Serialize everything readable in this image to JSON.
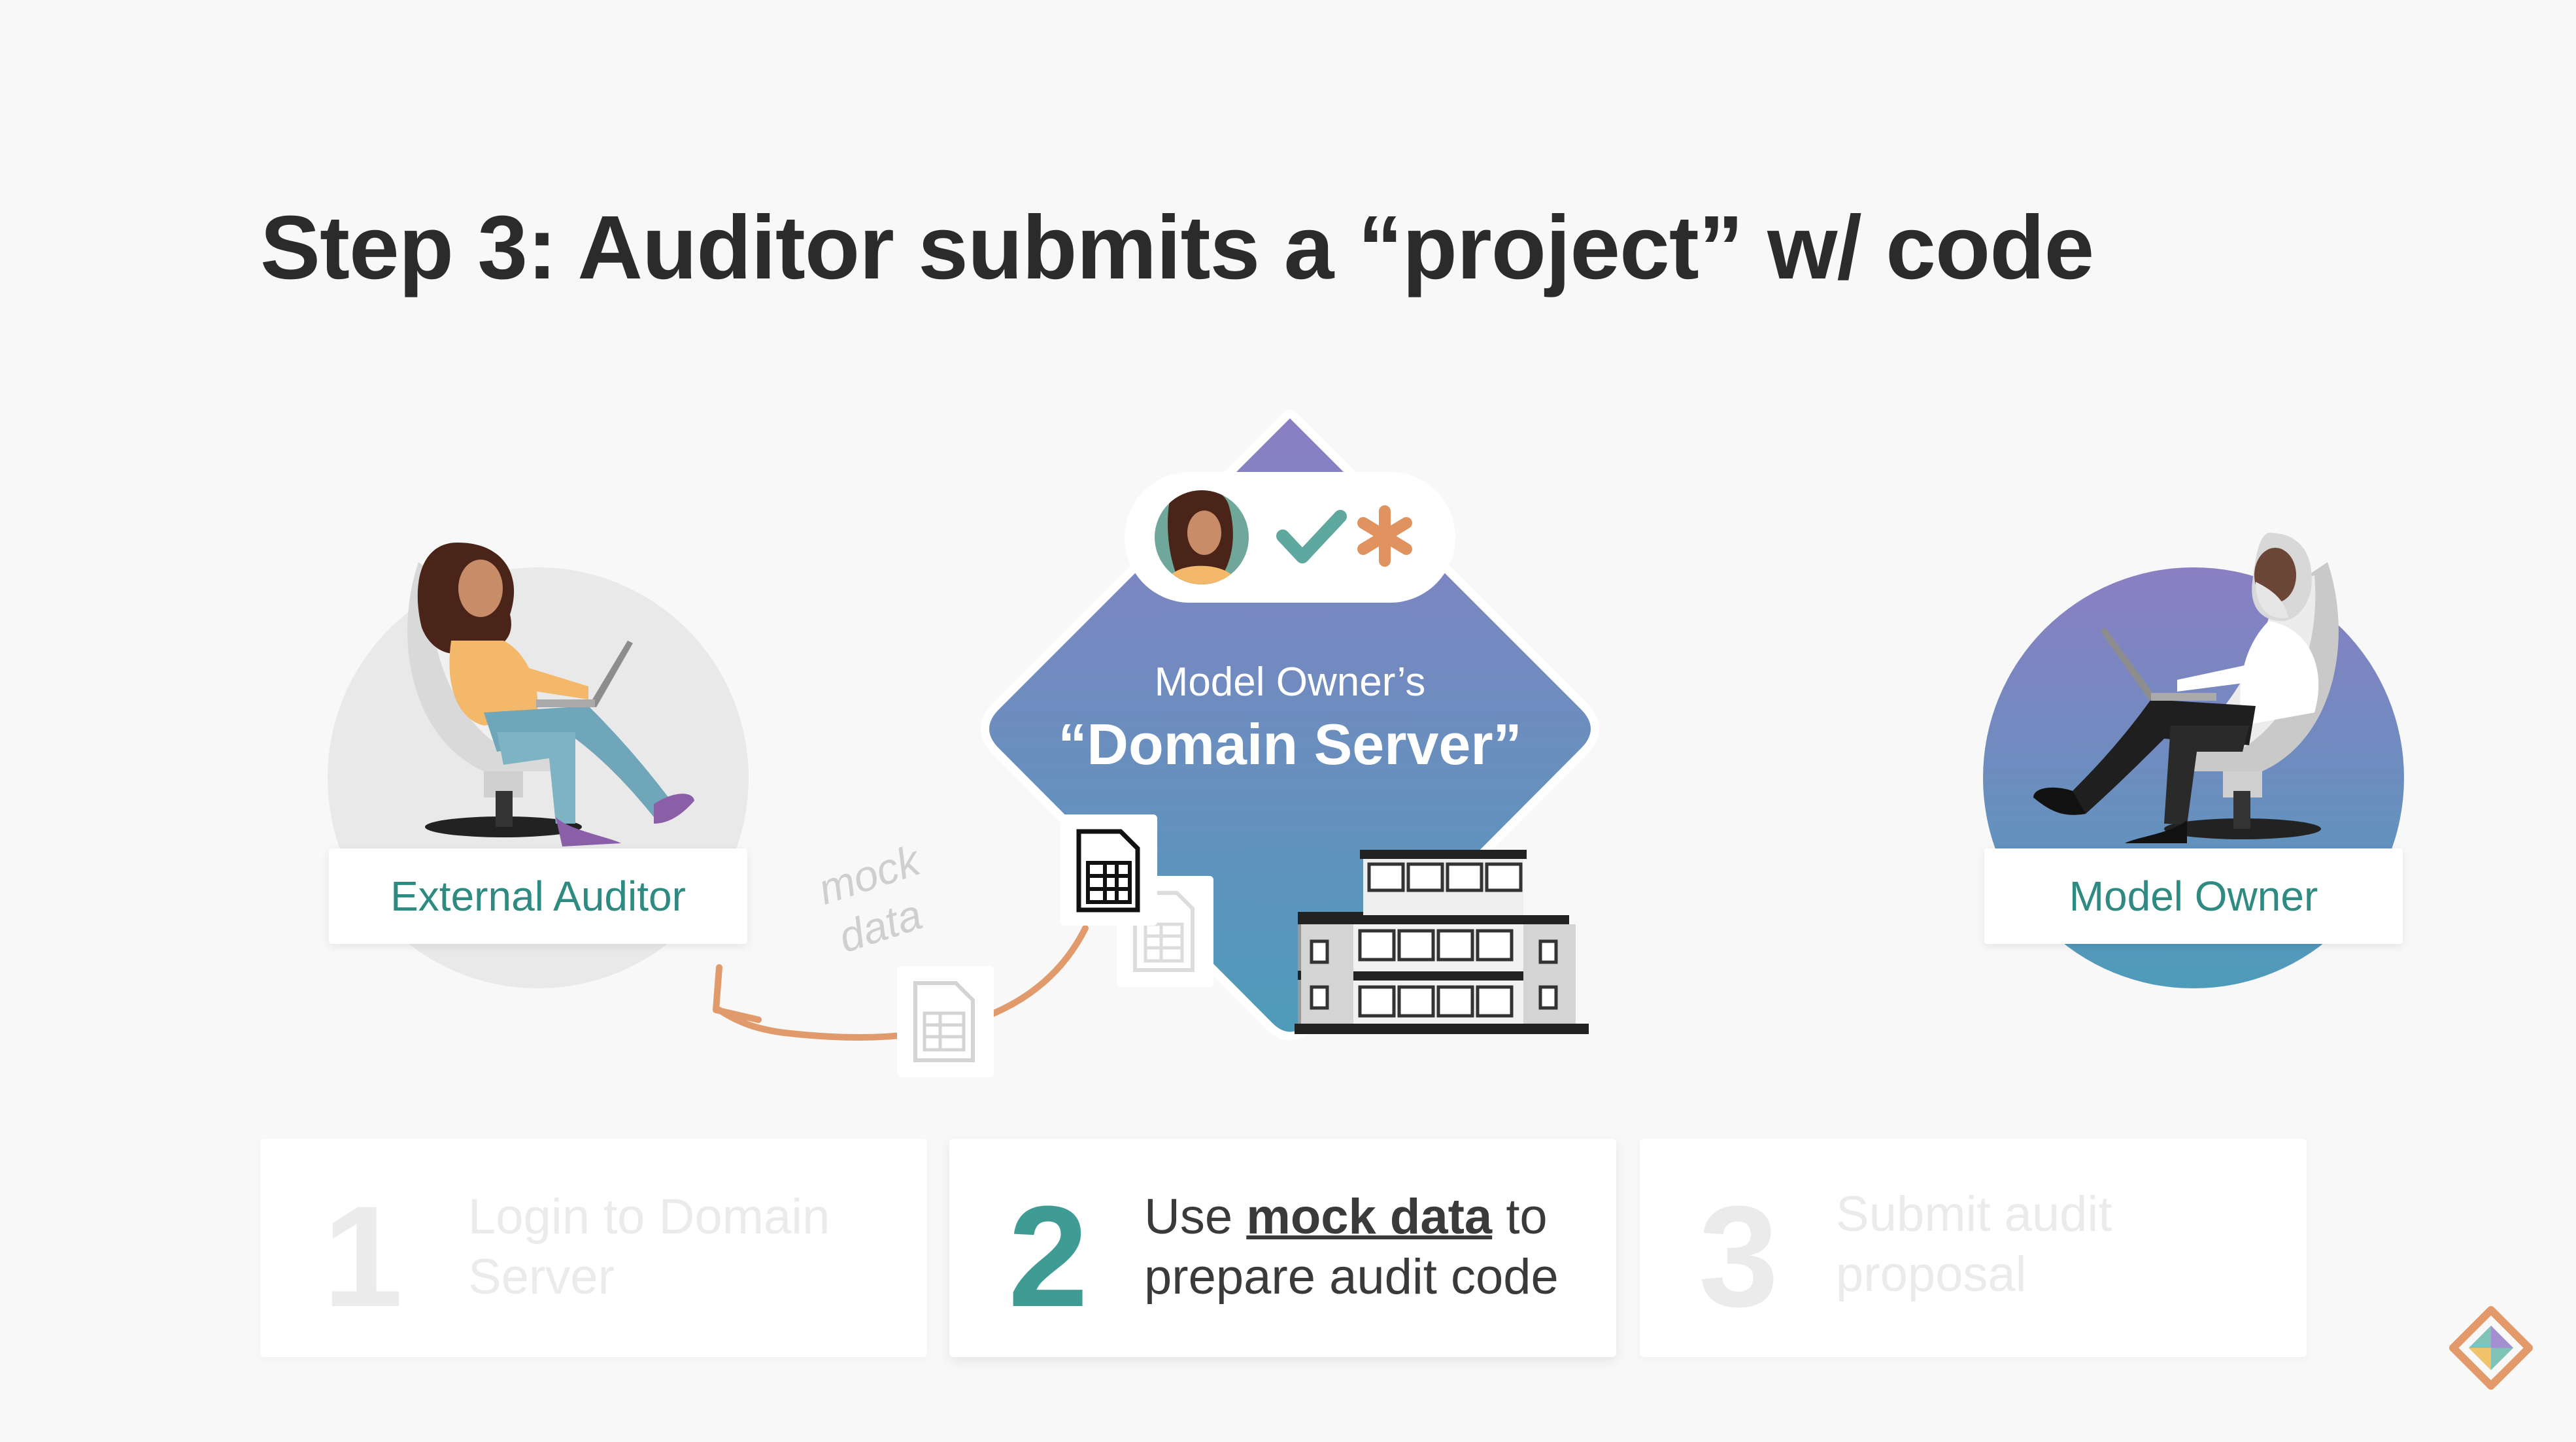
{
  "title": "Step 3: Auditor submits a “project” w/ code",
  "server": {
    "line1": "Model Owner’s",
    "line2": "“Domain Server”"
  },
  "auditor_label": "External Auditor",
  "owner_label": "Model Owner",
  "mock_data_label_1": "mock",
  "mock_data_label_2": "data",
  "steps": [
    {
      "number": "1",
      "line1": "Login to Domain",
      "line2": "Server",
      "state": "inactive"
    },
    {
      "number": "2",
      "prefix": "Use ",
      "highlight": "mock data",
      "suffix": " to",
      "line2": "prepare audit code",
      "state": "active"
    },
    {
      "number": "3",
      "line1": "Submit audit",
      "line2": "proposal",
      "state": "inactive"
    }
  ],
  "icons": [
    "check-icon",
    "asterisk-icon",
    "spreadsheet-icon",
    "building-icon",
    "logo-icon"
  ],
  "colors": {
    "accent_teal": "#3e9c95",
    "gradient_top": "#8a7fc3",
    "gradient_bottom": "#4e9bba",
    "arrow": "#e09a6c",
    "check": "#5fa8a0",
    "asterisk": "#e0935f"
  }
}
